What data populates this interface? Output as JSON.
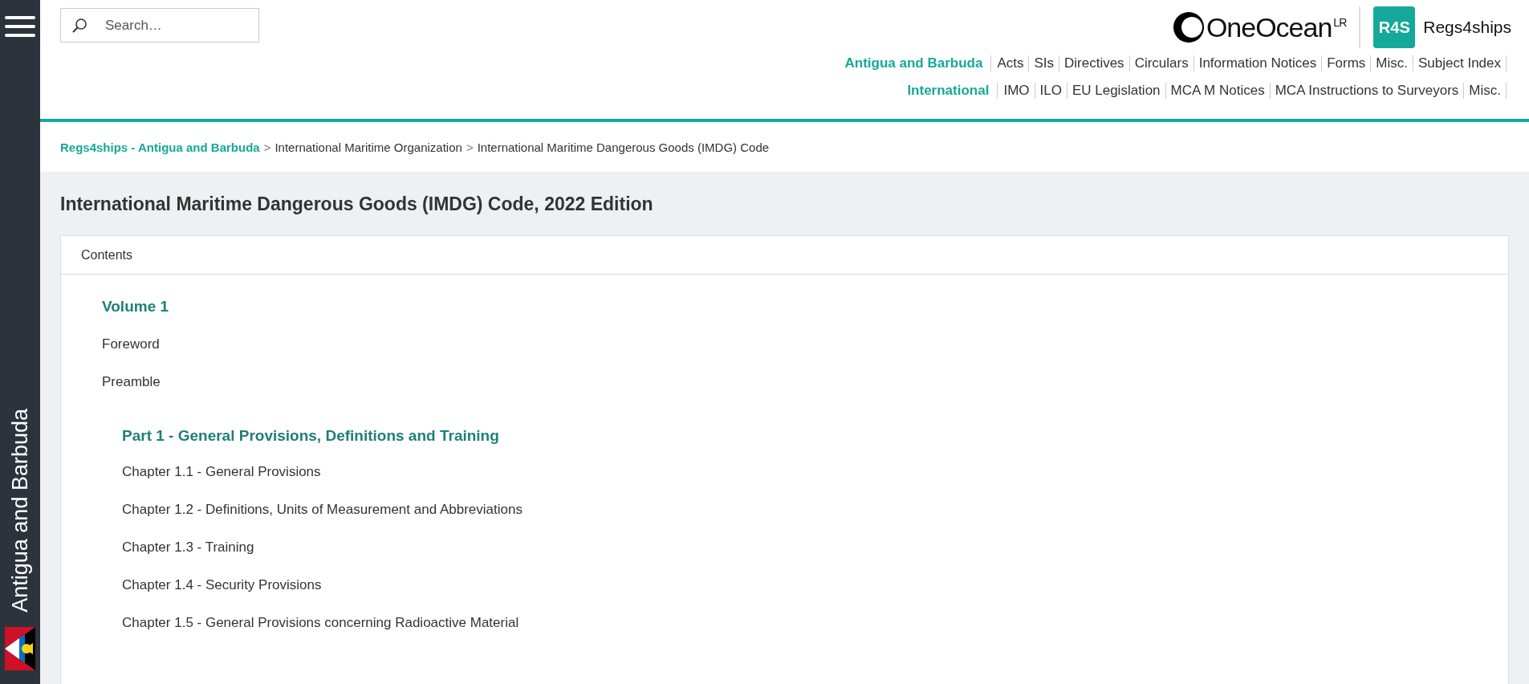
{
  "sidebar": {
    "region": "Antigua and Barbuda"
  },
  "search": {
    "placeholder": "Search…"
  },
  "brand": {
    "oneocean": "OneOcean",
    "oneocean_mark": "LR",
    "badge": "R4S",
    "name": "Regs4ships"
  },
  "nav_rows": [
    {
      "heading": "Antigua and Barbuda",
      "links": [
        "Acts",
        "SIs",
        "Directives",
        "Circulars",
        "Information Notices",
        "Forms",
        "Misc.",
        "Subject Index"
      ]
    },
    {
      "heading": "International",
      "links": [
        "IMO",
        "ILO",
        "EU Legislation",
        "MCA M Notices",
        "MCA Instructions to Surveyors",
        "Misc."
      ]
    }
  ],
  "breadcrumb": {
    "separator": ">",
    "items": [
      {
        "label": "Regs4ships - Antigua and Barbuda",
        "link": true
      },
      {
        "label": "International Maritime Organization",
        "link": false
      },
      {
        "label": "International Maritime Dangerous Goods (IMDG) Code",
        "link": false
      }
    ]
  },
  "page_title": "International Maritime Dangerous Goods (IMDG) Code, 2022 Edition",
  "contents": {
    "title": "Contents",
    "items": [
      {
        "kind": "heading",
        "label": "Volume 1"
      },
      {
        "kind": "entry",
        "label": "Foreword"
      },
      {
        "kind": "entry",
        "label": "Preamble"
      },
      {
        "kind": "heading",
        "label": "Part 1 - General Provisions, Definitions and Training",
        "children": [
          {
            "kind": "entry",
            "label": "Chapter 1.1 - General Provisions"
          },
          {
            "kind": "entry",
            "label": "Chapter 1.2 - Definitions, Units of Measurement and Abbreviations"
          },
          {
            "kind": "entry",
            "label": "Chapter 1.3 - Training"
          },
          {
            "kind": "entry",
            "label": "Chapter 1.4 - Security Provisions"
          },
          {
            "kind": "entry",
            "label": "Chapter 1.5 - General Provisions concerning Radioactive Material"
          }
        ]
      }
    ]
  }
}
